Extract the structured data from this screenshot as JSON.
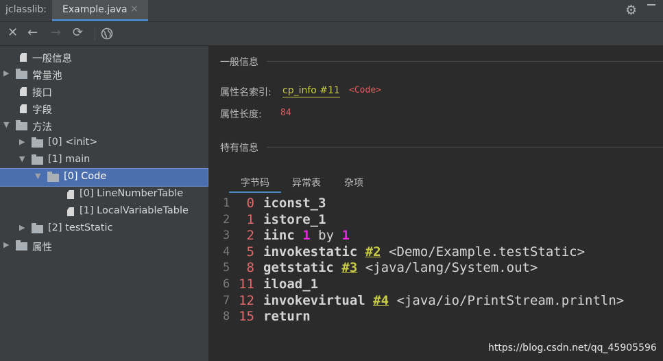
{
  "titlebar": {
    "app_label": "jclasslib:",
    "tab_label": "Example.java",
    "tab_close": "×",
    "settings_icon": "gear-icon"
  },
  "toolbar": {
    "close": "✕",
    "back": "←",
    "forward": "→",
    "refresh": "⟳",
    "web": "🌐"
  },
  "tree": [
    {
      "label": "一般信息",
      "icon": "file",
      "arrow": ""
    },
    {
      "label": "常量池",
      "icon": "folder",
      "arrow": "▶"
    },
    {
      "label": "接口",
      "icon": "file",
      "arrow": ""
    },
    {
      "label": "字段",
      "icon": "file",
      "arrow": ""
    },
    {
      "label": "方法",
      "icon": "folder",
      "arrow": "▼"
    },
    {
      "label": "[0] <init>",
      "icon": "folder",
      "arrow": "▶"
    },
    {
      "label": "[1] main",
      "icon": "folder",
      "arrow": "▼"
    },
    {
      "label": "[0] Code",
      "icon": "folder",
      "arrow": "▼",
      "selected": true
    },
    {
      "label": "[0] LineNumberTable",
      "icon": "file",
      "arrow": ""
    },
    {
      "label": "[1] LocalVariableTable",
      "icon": "file",
      "arrow": ""
    },
    {
      "label": "[2] testStatic",
      "icon": "folder",
      "arrow": "▶"
    },
    {
      "label": "属性",
      "icon": "folder",
      "arrow": "▶"
    }
  ],
  "general": {
    "section_title": "一般信息",
    "name_index_label": "属性名索引:",
    "name_index_link": "cp_info #11",
    "name_index_tag": "<Code>",
    "length_label": "属性长度:",
    "length_value": "84"
  },
  "specific": {
    "section_title": "特有信息",
    "tabs": [
      "字节码",
      "异常表",
      "杂项"
    ]
  },
  "bytecode": [
    {
      "line": "1",
      "offset": "0",
      "op": "iconst_3"
    },
    {
      "line": "2",
      "offset": "1",
      "op": "istore_1"
    },
    {
      "line": "3",
      "offset": "2",
      "op": "iinc",
      "arg1": "1",
      "mid": "by",
      "arg2": "1"
    },
    {
      "line": "4",
      "offset": "5",
      "op": "invokestatic",
      "ref": "#2",
      "comment": "<Demo/Example.testStatic>"
    },
    {
      "line": "5",
      "offset": "8",
      "op": "getstatic",
      "ref": "#3",
      "comment": "<java/lang/System.out>"
    },
    {
      "line": "6",
      "offset": "11",
      "op": "iload_1"
    },
    {
      "line": "7",
      "offset": "12",
      "op": "invokevirtual",
      "ref": "#4",
      "comment": "<java/io/PrintStream.println>"
    },
    {
      "line": "8",
      "offset": "15",
      "op": "return"
    }
  ],
  "watermark": "https://blog.csdn.net/qq_45905596",
  "colors": {
    "accent": "#4a88c7",
    "selection": "#4b6eaf",
    "link": "#c8cc44",
    "offset": "#e36a6a",
    "number": "#e02ad6"
  }
}
